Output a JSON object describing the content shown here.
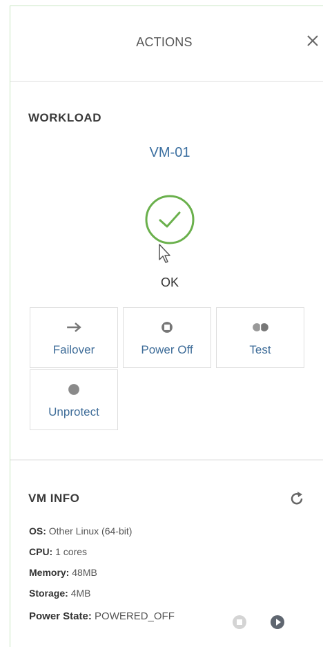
{
  "header": {
    "title": "ACTIONS",
    "close_icon": "close-icon"
  },
  "workload": {
    "section_title": "WORKLOAD",
    "vm_name": "VM-01",
    "status_icon": "check-circle-icon",
    "status_text": "OK",
    "actions": [
      {
        "label": "Failover",
        "icon": "arrow-right-icon"
      },
      {
        "label": "Power Off",
        "icon": "power-off-icon"
      },
      {
        "label": "Test",
        "icon": "test-icon"
      },
      {
        "label": "Unprotect",
        "icon": "unprotect-icon"
      }
    ]
  },
  "vm_info": {
    "section_title": "VM INFO",
    "refresh_icon": "refresh-icon",
    "os": {
      "label": "OS:",
      "value": "Other Linux (64-bit)"
    },
    "cpu": {
      "label": "CPU:",
      "value": "1 cores"
    },
    "memory": {
      "label": "Memory:",
      "value": "48MB"
    },
    "storage": {
      "label": "Storage:",
      "value": "4MB"
    },
    "power_state": {
      "label": "Power State:",
      "value": "POWERED_OFF"
    },
    "power_controls": [
      "stop-icon",
      "play-icon"
    ]
  },
  "colors": {
    "accent_link": "#3b6fa0",
    "status_ok": "#6ab04c",
    "panel_border": "#c8e6c0"
  }
}
